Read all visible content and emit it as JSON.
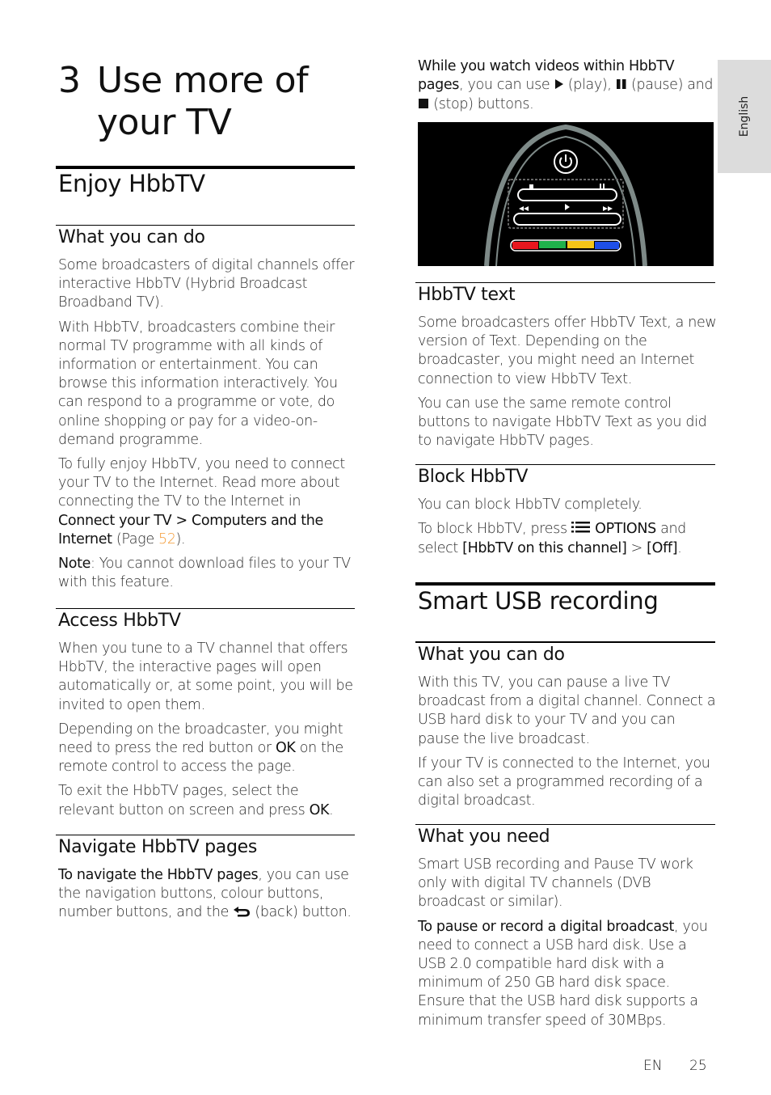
{
  "sidebar_tab": {
    "label": "English"
  },
  "chapter": {
    "number": "3",
    "title": "Use more of your TV"
  },
  "left": {
    "section1": {
      "heading": "Enjoy HbbTV",
      "sub1": {
        "heading": "What you can do",
        "p1": "Some broadcasters of digital channels offer interactive HbbTV (Hybrid Broadcast Broadband TV).",
        "p2": "With HbbTV, broadcasters combine their normal TV programme with all kinds of information or entertainment. You can browse this information interactively. You can respond to a programme or vote, do online shopping or pay for a video-on-demand programme.",
        "p3_a": "To fully enjoy HbbTV, you need to connect your TV to the Internet. Read more about connecting the TV to the Internet in ",
        "p3_bold": "Connect your TV > Computers and the Internet",
        "p3_b": " (Page ",
        "p3_link": "52",
        "p3_c": ").",
        "note_label": "Note",
        "note_text": ": You cannot download files to your TV with this feature."
      },
      "sub2": {
        "heading": "Access HbbTV",
        "p1": "When you tune to a TV channel that offers HbbTV, the interactive pages will open automatically or, at some point, you will be invited to open them.",
        "p2_a": "Depending on the broadcaster, you might need to press the red button or ",
        "p2_bold": "OK",
        "p2_b": " on the remote control to access the page.",
        "p3_a": "To exit the HbbTV pages, select the relevant button on screen and press ",
        "p3_bold": "OK",
        "p3_b": "."
      },
      "sub3": {
        "heading": "Navigate HbbTV pages",
        "p1_bold": "To navigate the HbbTV pages",
        "p1_a": ", you can use the navigation buttons, colour buttons, number buttons, and the ",
        "p1_icon": "back-icon",
        "p1_b": " (back) button."
      }
    }
  },
  "right": {
    "intro": {
      "bold": "While you watch videos within HbbTV pages",
      "a": ", you can use ",
      "play": "(play),",
      "pause": "(pause) and",
      "stop": "(stop) buttons."
    },
    "remote_image": {
      "alt": "Remote control with power, stop, pause, rewind, play, fast-forward and colour buttons",
      "colors": [
        "#e8171e",
        "#1fb14b",
        "#f5c518",
        "#1f4fe8"
      ]
    },
    "hbbtv_text": {
      "heading": "HbbTV text",
      "p1": "Some broadcasters offer HbbTV Text, a new version of Text. Depending on the broadcaster, you might need an Internet connection to view HbbTV Text.",
      "p2": "You can use the same remote control buttons to navigate HbbTV Text as you did to navigate HbbTV pages."
    },
    "block_hbbtv": {
      "heading": "Block HbbTV",
      "p1": "You can block HbbTV completely.",
      "p2_a": "To block HbbTV, press ",
      "p2_options": "OPTIONS",
      "p2_b": " and select ",
      "p2_bold1": "[HbbTV on this channel]",
      "p2_c": " > ",
      "p2_bold2": "[Off]",
      "p2_d": "."
    },
    "smart_usb": {
      "heading": "Smart USB recording",
      "sub1": {
        "heading": "What you can do",
        "p1": "With this TV, you can pause a live TV broadcast from a digital channel. Connect a USB hard disk to your TV and you can pause the live broadcast.",
        "p2": "If your TV is connected to the Internet, you can also set a programmed recording of a digital broadcast."
      },
      "sub2": {
        "heading": "What you need",
        "p1": "Smart USB recording and Pause TV work only with digital TV channels (DVB broadcast or similar).",
        "p2_bold": "To pause or record a digital broadcast",
        "p2_a": ", you need to connect a USB hard disk. Use a USB 2.0 compatible hard disk with a minimum of 250 GB hard disk space. Ensure that the USB hard disk supports a minimum transfer speed of 30MBps."
      }
    }
  },
  "footer": {
    "lang": "EN",
    "page": "25"
  }
}
